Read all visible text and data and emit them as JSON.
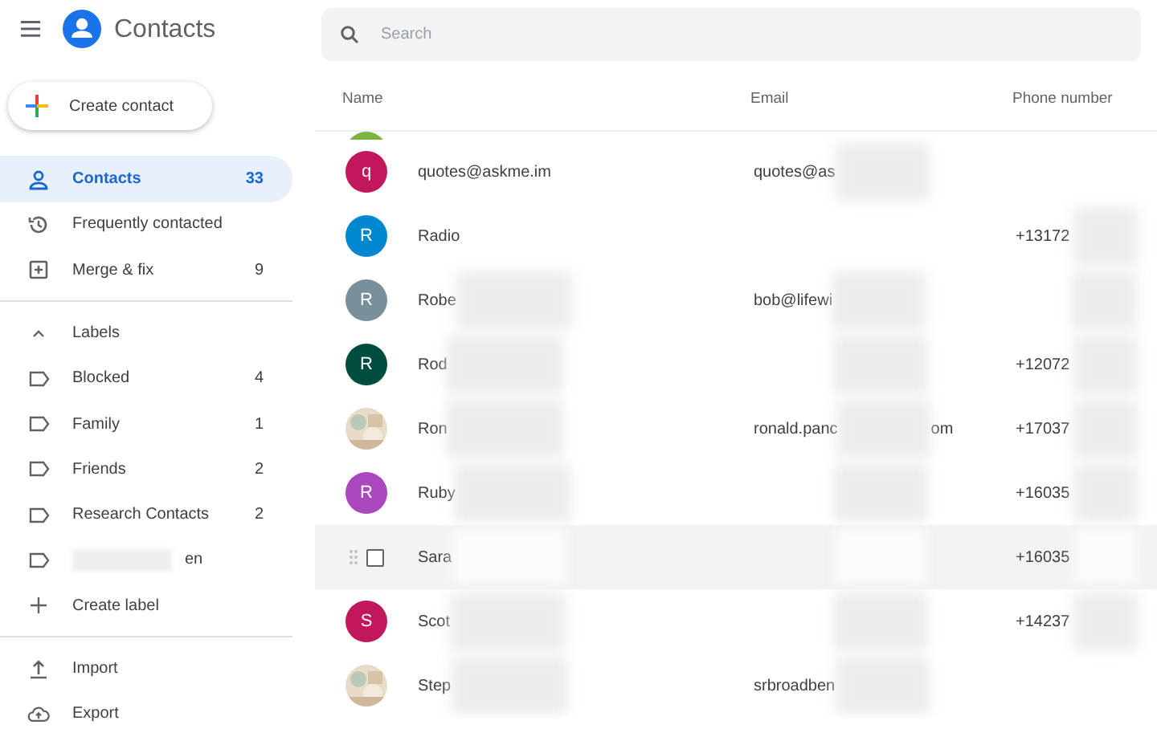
{
  "app": {
    "title": "Contacts"
  },
  "create_button": "Create contact",
  "search": {
    "placeholder": "Search"
  },
  "nav": [
    {
      "label": "Contacts",
      "count": "33",
      "selected": true
    },
    {
      "label": "Frequently contacted",
      "selected": false
    },
    {
      "label": "Merge & fix",
      "count": "9",
      "selected": false
    }
  ],
  "labels": {
    "heading": "Labels",
    "expanded": true,
    "items": [
      {
        "name": "Blocked",
        "count": "4"
      },
      {
        "name": "Family",
        "count": "1"
      },
      {
        "name": "Friends",
        "count": "2"
      },
      {
        "name": "Research Contacts",
        "count": "2"
      },
      {
        "name": "en",
        "blurred": true
      }
    ],
    "create": "Create label"
  },
  "actions": [
    {
      "label": "Import"
    },
    {
      "label": "Export"
    }
  ],
  "table": {
    "columns": [
      "Name",
      "Email",
      "Phone number"
    ],
    "rows": [
      {
        "kind": "partial",
        "avatar": {
          "kind": "letter",
          "color": "#7cb342"
        }
      },
      {
        "kind": "contact",
        "hovered": false,
        "avatar": {
          "kind": "letter",
          "letter": "q",
          "color": "#c2185b"
        },
        "name": "quotes@askme.im",
        "email": "quotes@as",
        "email_blurred": true
      },
      {
        "kind": "contact",
        "hovered": false,
        "avatar": {
          "kind": "letter",
          "letter": "R",
          "color": "#0288d1"
        },
        "name": "Radio",
        "phone": "+13172",
        "phone_blurred": true
      },
      {
        "kind": "contact",
        "hovered": false,
        "avatar": {
          "kind": "letter",
          "letter": "R",
          "color": "#78909c"
        },
        "name": "Robe",
        "email": "bob@lifewi",
        "name_blurred": true,
        "email_blurred": true,
        "phone_blurred": true
      },
      {
        "kind": "contact",
        "hovered": false,
        "avatar": {
          "kind": "letter",
          "letter": "R",
          "color": "#004d40"
        },
        "name": "Rod",
        "phone": "+12072",
        "name_blurred": true,
        "email_blurred": true,
        "phone_blurred": true
      },
      {
        "kind": "contact",
        "hovered": false,
        "name": "Ron",
        "email": "ronald.panc",
        "email_tail": "om",
        "phone": "+17037",
        "name_blurred": true,
        "email_blurred": true,
        "phone_blurred": true
      },
      {
        "kind": "contact",
        "hovered": false,
        "avatar": {
          "kind": "letter",
          "letter": "R",
          "color": "#ab47bc"
        },
        "name": "Ruby",
        "phone": "+16035",
        "name_blurred": true,
        "email_blurred": true,
        "phone_blurred": true
      },
      {
        "kind": "contact",
        "hovered": true,
        "checked": false,
        "name": "Sara",
        "phone": "+16035",
        "name_blurred": true,
        "email_blurred": true,
        "phone_blurred": true
      },
      {
        "kind": "contact",
        "hovered": false,
        "avatar": {
          "kind": "letter",
          "letter": "S",
          "color": "#c2185b"
        },
        "name": "Scot",
        "phone": "+14237",
        "name_blurred": true,
        "email_blurred": true,
        "phone_blurred": true
      },
      {
        "kind": "contact",
        "hovered": false,
        "name": "Step",
        "email": "srbroadben",
        "name_blurred": true,
        "email_blurred": true
      }
    ]
  }
}
